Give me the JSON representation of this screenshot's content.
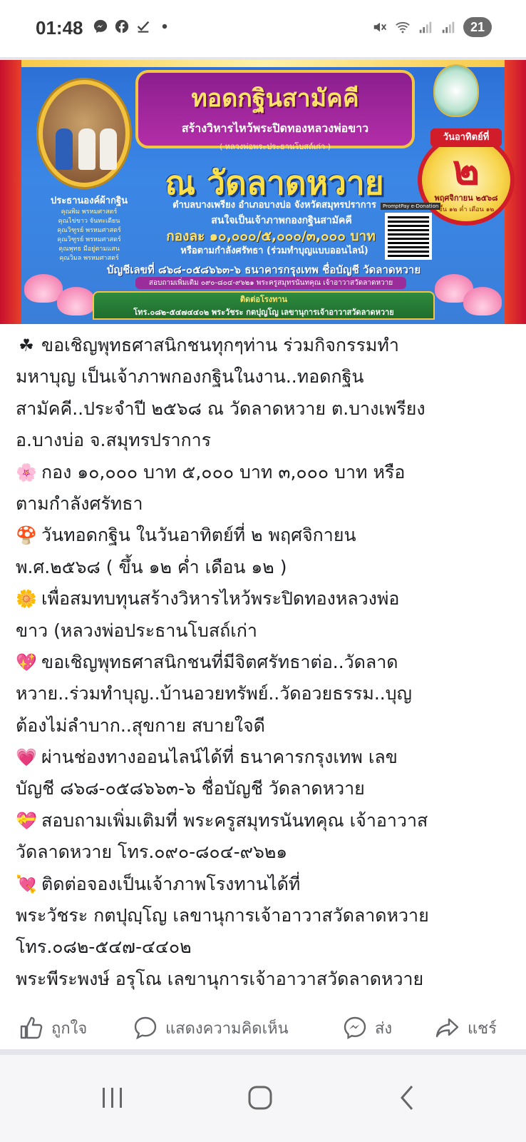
{
  "status_bar": {
    "time": "01:48",
    "left_icons": [
      "messenger-icon",
      "facebook-icon",
      "download-check-icon",
      "dot-icon"
    ],
    "right_icons": [
      "mute-icon",
      "wifi-icon",
      "signal-icon",
      "signal-icon"
    ],
    "battery": "21"
  },
  "banner": {
    "title": "ทอดกฐินสามัคคี",
    "subtitle": "สร้างวิหารไหว้พระปิดทองหลวงพ่อขาว",
    "subtitle_note": "( หลวงพ่อพระประธานโบสถ์เก่า )",
    "temple": "ณ วัดลาดหวาย",
    "location": "ตำบลบางเพรียง อำเภอบางบ่อ จังหวัดสมุทรปราการ",
    "date_header": "วันอาทิตย์ที่",
    "date_day": "๒",
    "date_month": "พฤศจิกายน ๒๕๖๘",
    "date_lunar": "ขึ้น ๑๒ ค่ำ เดือน ๑๒",
    "chair_title": "ประธานองค์ผ้ากฐิน",
    "chair_names": [
      "คุณพิม พรหมศาสตร์",
      "คุณไข่ขาว จันทะเดียน",
      "คุณวิฑูรย์ พรหมศาสตร์",
      "คุณวิฑูรย์ พรหมศาสตร์",
      "คุณพุทธ มีอยู่ตามแสน",
      "คุณวิมล พรหมศาสตร์"
    ],
    "offer_line1": "สนใจเป็นเจ้าภาพกองกฐินสามัคคี",
    "offer_line2": "กองละ ๑๐,๐๐๐/๕,๐๐๐/๓,๐๐๐ บาท",
    "offer_line3": "หรือตามกำลังศรัทธา (ร่วมทำบุญแบบออนไลน์)",
    "qr_label": "PromptPay e-Donation",
    "account_line": "บัญชีเลขที่ ๘๖๘-๐๕๘๖๖๓-๖ ธนาคารกรุงเทพ ชื่อบัญชี วัดลาดหวาย",
    "inquiry_line": "สอบถามเพิ่มเติม ๐๙๐-๘๐๔-๙๖๒๑ พระครูสมุทรนันทคุณ เจ้าอาวาสวัดลาดหวาย",
    "contact_title": "ติดต่อโรงทาน",
    "contact_text": "โทร.๐๘๒-๕๔๗๔๔๐๒ พระวัชระ กตปุญโญ เลขานุการเจ้าอาวาสวัดลาดหวาย"
  },
  "post": {
    "lines": [
      {
        "emoji": "☘",
        "emoji_name": "clover-icon",
        "text": "ขอเชิญพุทธศาสนิกชนทุกๆท่าน ร่วมกิจกรรมทำ"
      },
      {
        "emoji": "",
        "text": "มหาบุญ เป็นเจ้าภาพกองกฐินในงาน..ทอดกฐิน"
      },
      {
        "emoji": "",
        "text": "สามัคคี..ประจำปี ๒๕๖๘  ณ วัดลาดหวาย ต.บางเพรียง"
      },
      {
        "emoji": "",
        "text": "อ.บางบ่อ จ.สมุทรปราการ"
      },
      {
        "emoji": "🌸",
        "emoji_name": "cherry-blossom-icon",
        "text": "กอง ๑๐,๐๐๐ บาท ๕,๐๐๐ บาท ๓,๐๐๐ บาท หรือ"
      },
      {
        "emoji": "",
        "text": "ตามกำลังศรัทธา"
      },
      {
        "emoji": "🍄",
        "emoji_name": "mushroom-icon",
        "text": "วันทอดกฐิน ในวันอาทิตย์ที่ ๒ พฤศจิกายน"
      },
      {
        "emoji": "",
        "text": "พ.ศ.๒๕๖๘ ( ขึ้น ๑๒ ค่ำ เดือน ๑๒ )"
      },
      {
        "emoji": "🌼",
        "emoji_name": "blossom-icon",
        "text": "เพื่อสมทบทุนสร้างวิหารไหว้พระปิดทองหลวงพ่อ"
      },
      {
        "emoji": "",
        "text": "ขาว (หลวงพ่อประธานโบสถ์เก่า"
      },
      {
        "emoji": "💖",
        "emoji_name": "sparkling-heart-icon",
        "text": "ขอเชิญพุทธศาสนิกชนที่มีจิตศรัทธาต่อ..วัดลาด"
      },
      {
        "emoji": "",
        "text": "หวาย..ร่วมทำบุญ..บ้านอวยทรัพย์..วัดอวยธรรม..บุญ"
      },
      {
        "emoji": "",
        "text": "ต้องไม่ลำบาก..สุขกาย สบายใจดี"
      },
      {
        "emoji": "💗",
        "emoji_name": "growing-heart-icon",
        "text": "ผ่านช่องทางออนไลน์ได้ที่ ธนาคารกรุงเทพ เลข"
      },
      {
        "emoji": "",
        "text": "บัญชี ๘๖๘-๐๕๘๖๖๓-๖ ชื่อบัญชี วัดลาดหวาย"
      },
      {
        "emoji": "💝",
        "emoji_name": "heart-ribbon-icon",
        "text": "สอบถามเพิ่มเติมที่  พระครูสมุทรนันทคุณ เจ้าอาวาส"
      },
      {
        "emoji": "",
        "text": "วัดลาดหวาย โทร.๐๙๐-๘๐๔-๙๖๒๑"
      },
      {
        "emoji": "💘",
        "emoji_name": "heart-arrow-icon",
        "text": "ติดต่อจองเป็นเจ้าภาพโรงทานได้ที่"
      },
      {
        "emoji": "",
        "text": "พระวัชระ กตปุญฺโญ เลขานุการเจ้าอาวาสวัดลาดหวาย"
      },
      {
        "emoji": "",
        "text": "โทร.๐๘๒-๕๔๗-๔๔๐๒"
      },
      {
        "emoji": "",
        "text": "พระพีระพงษ์  อรุโณ  เลขานุการเจ้าอาวาสวัดลาดหวาย"
      }
    ]
  },
  "actions": {
    "like": "ถูกใจ",
    "comment": "แสดงความคิดเห็น",
    "send": "ส่ง",
    "share": "แชร์"
  },
  "colors": {
    "text": "#1c1e21",
    "action_gray": "#65676b",
    "divider": "#e4e6eb"
  }
}
